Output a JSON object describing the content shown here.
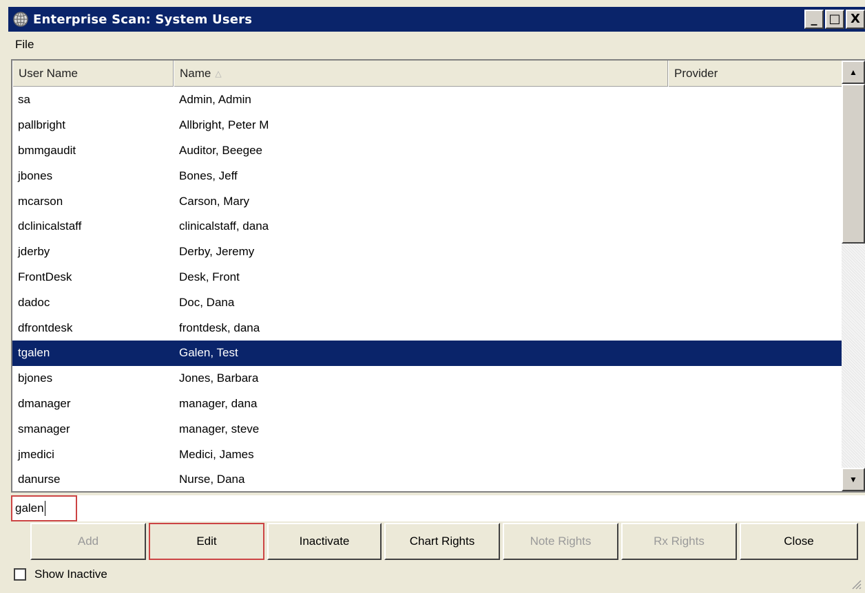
{
  "window": {
    "title": "Enterprise Scan: System Users",
    "icon": "globe-icon",
    "controls": {
      "minimize": "_",
      "maximize": "□",
      "close": "X"
    }
  },
  "menubar": {
    "items": [
      "File"
    ]
  },
  "list": {
    "columns": {
      "user_name": "User Name",
      "name": "Name",
      "provider": "Provider"
    },
    "sort_indicator": "△",
    "rows": [
      {
        "user_name": "sa",
        "name": "Admin, Admin",
        "provider": "",
        "selected": false
      },
      {
        "user_name": "pallbright",
        "name": "Allbright, Peter M",
        "provider": "",
        "selected": false
      },
      {
        "user_name": "bmmgaudit",
        "name": "Auditor, Beegee",
        "provider": "",
        "selected": false
      },
      {
        "user_name": "jbones",
        "name": "Bones, Jeff",
        "provider": "",
        "selected": false
      },
      {
        "user_name": "mcarson",
        "name": "Carson, Mary",
        "provider": "",
        "selected": false
      },
      {
        "user_name": "dclinicalstaff",
        "name": "clinicalstaff, dana",
        "provider": "",
        "selected": false
      },
      {
        "user_name": "jderby",
        "name": "Derby, Jeremy",
        "provider": "",
        "selected": false
      },
      {
        "user_name": "FrontDesk",
        "name": "Desk, Front",
        "provider": "",
        "selected": false
      },
      {
        "user_name": "dadoc",
        "name": "Doc, Dana",
        "provider": "",
        "selected": false
      },
      {
        "user_name": "dfrontdesk",
        "name": "frontdesk, dana",
        "provider": "",
        "selected": false
      },
      {
        "user_name": "tgalen",
        "name": "Galen, Test",
        "provider": "",
        "selected": true
      },
      {
        "user_name": "bjones",
        "name": "Jones, Barbara",
        "provider": "",
        "selected": false
      },
      {
        "user_name": "dmanager",
        "name": "manager, dana",
        "provider": "",
        "selected": false
      },
      {
        "user_name": "smanager",
        "name": "manager, steve",
        "provider": "",
        "selected": false
      },
      {
        "user_name": "jmedici",
        "name": "Medici, James",
        "provider": "",
        "selected": false
      },
      {
        "user_name": "danurse",
        "name": "Nurse, Dana",
        "provider": "",
        "selected": false
      }
    ]
  },
  "search": {
    "value": "galen"
  },
  "buttons": {
    "add": {
      "label": "Add",
      "mnemonic": "A",
      "enabled": false
    },
    "edit": {
      "label": "Edit",
      "mnemonic": "E",
      "enabled": true
    },
    "inactivate": {
      "label": "Inactivate",
      "enabled": true
    },
    "chart_rights": {
      "label": "Chart Rights",
      "mnemonic": "R",
      "enabled": true
    },
    "note_rights": {
      "label": "Note Rights",
      "mnemonic": "N",
      "enabled": false
    },
    "rx_rights": {
      "label": "Rx Rights",
      "mnemonic": "R",
      "enabled": false
    },
    "close": {
      "label": "Close",
      "mnemonic": "C",
      "enabled": true
    }
  },
  "show_inactive": {
    "label": "Show Inactive",
    "checked": false
  },
  "colors": {
    "titlebar": "#0a246a",
    "selection": "#0a246a",
    "face": "#ece9d8",
    "focus_border": "#cc4444",
    "disabled_text": "#9a9a9a"
  }
}
